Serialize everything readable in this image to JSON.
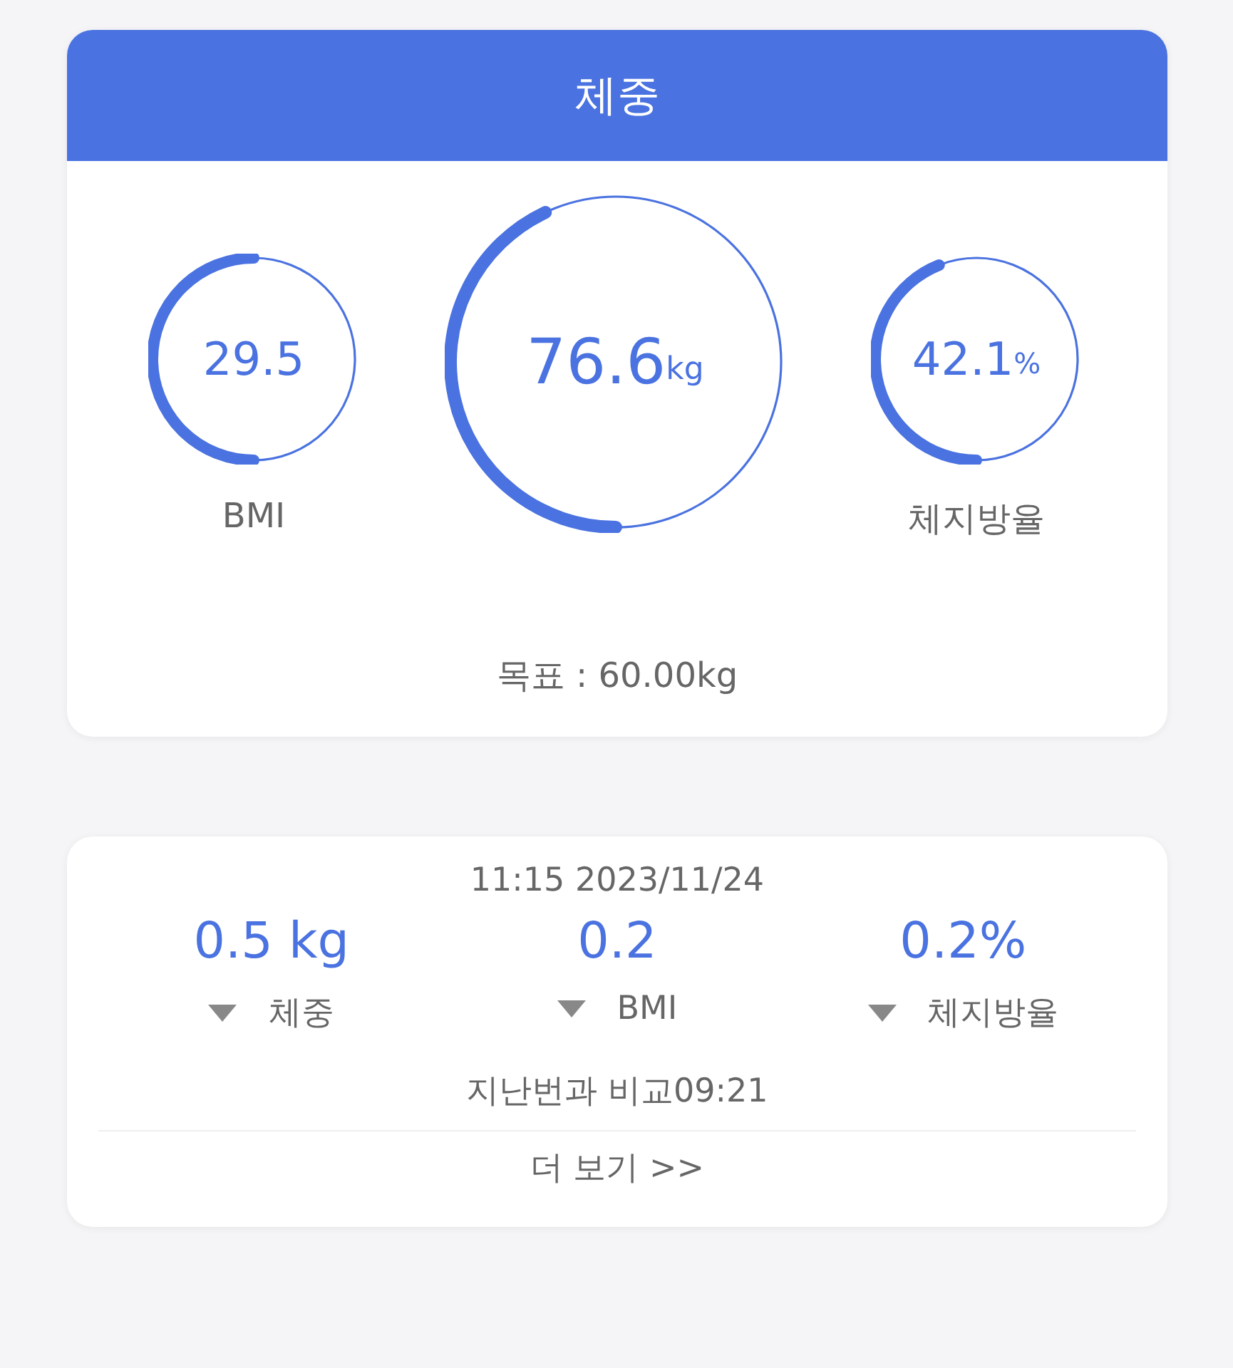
{
  "weight_card": {
    "title": "체중",
    "gauges": [
      {
        "kind": "small",
        "value": "29.5",
        "label": "BMI",
        "level": 0.5
      },
      {
        "kind": "large",
        "value": "76.6",
        "unit": "kg",
        "level": 0.43
      },
      {
        "kind": "small",
        "value": "42.1",
        "unit": "%",
        "label": "체지방율",
        "level": 0.44
      }
    ],
    "goal": "목표 : 60.00kg"
  },
  "compare_card": {
    "timestamp": "11:15 2023/11/24",
    "changes": [
      {
        "value": "0.5 kg",
        "label": "체중"
      },
      {
        "value": "0.2",
        "label": "BMI"
      },
      {
        "value": "0.2%",
        "label": "체지방율"
      }
    ],
    "compare_note": "지난번과 비교09:21",
    "more_link": "더 보기 >>"
  }
}
